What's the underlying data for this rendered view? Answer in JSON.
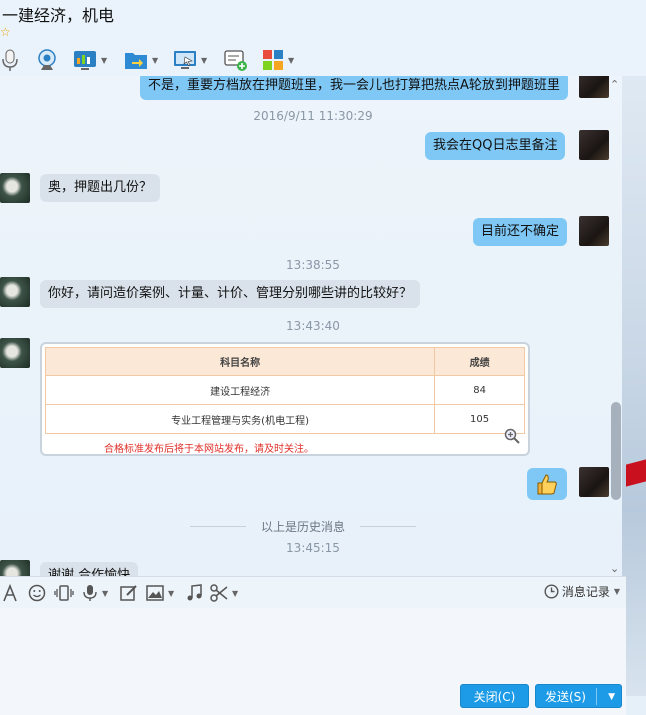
{
  "header": {
    "title": "一建经济，机电",
    "star": "☆"
  },
  "toolbar": {
    "icons": [
      "microphone-icon",
      "webcam-icon",
      "screen-share-icon",
      "file-transfer-icon",
      "remote-desktop-icon",
      "message-add-icon",
      "apps-icon"
    ]
  },
  "chat": {
    "messages": [
      {
        "from": "me",
        "text": "不是，重要方档放在押题班里，我一会儿也打算把热点A轮放到押题班里"
      },
      {
        "type": "time",
        "text": "2016/9/11 11:30:29"
      },
      {
        "from": "me",
        "text": "我会在QQ日志里备注"
      },
      {
        "from": "them",
        "text": "奥，押题出几份？"
      },
      {
        "from": "me",
        "text": "目前还不确定"
      },
      {
        "type": "time",
        "text": "13:38:55"
      },
      {
        "from": "them",
        "text": "你好，请问造价案例、计量、计价、管理分别哪些讲的比较好？"
      },
      {
        "type": "time",
        "text": "13:43:40"
      },
      {
        "from": "me",
        "type": "thumbs-up"
      },
      {
        "type": "divider",
        "text": "以上是历史消息"
      },
      {
        "type": "time",
        "text": "13:45:15"
      },
      {
        "from": "them",
        "text": "谢谢 合作愉快"
      }
    ],
    "score_table": {
      "headers": [
        "科目名称",
        "成绩"
      ],
      "rows": [
        {
          "subject": "建设工程经济",
          "score": "84"
        },
        {
          "subject": "专业工程管理与实务(机电工程)",
          "score": "105"
        }
      ],
      "note": "合格标准发布后将于本网站发布，请及时关注。"
    }
  },
  "input_toolbar": {
    "icons": [
      "font-icon",
      "emoji-icon",
      "vibrate-icon",
      "voice-icon",
      "edit-icon",
      "image-icon",
      "music-icon",
      "scissors-icon"
    ],
    "history_label": "消息记录"
  },
  "buttons": {
    "close": "关闭(C)",
    "send": "发送(S)"
  }
}
